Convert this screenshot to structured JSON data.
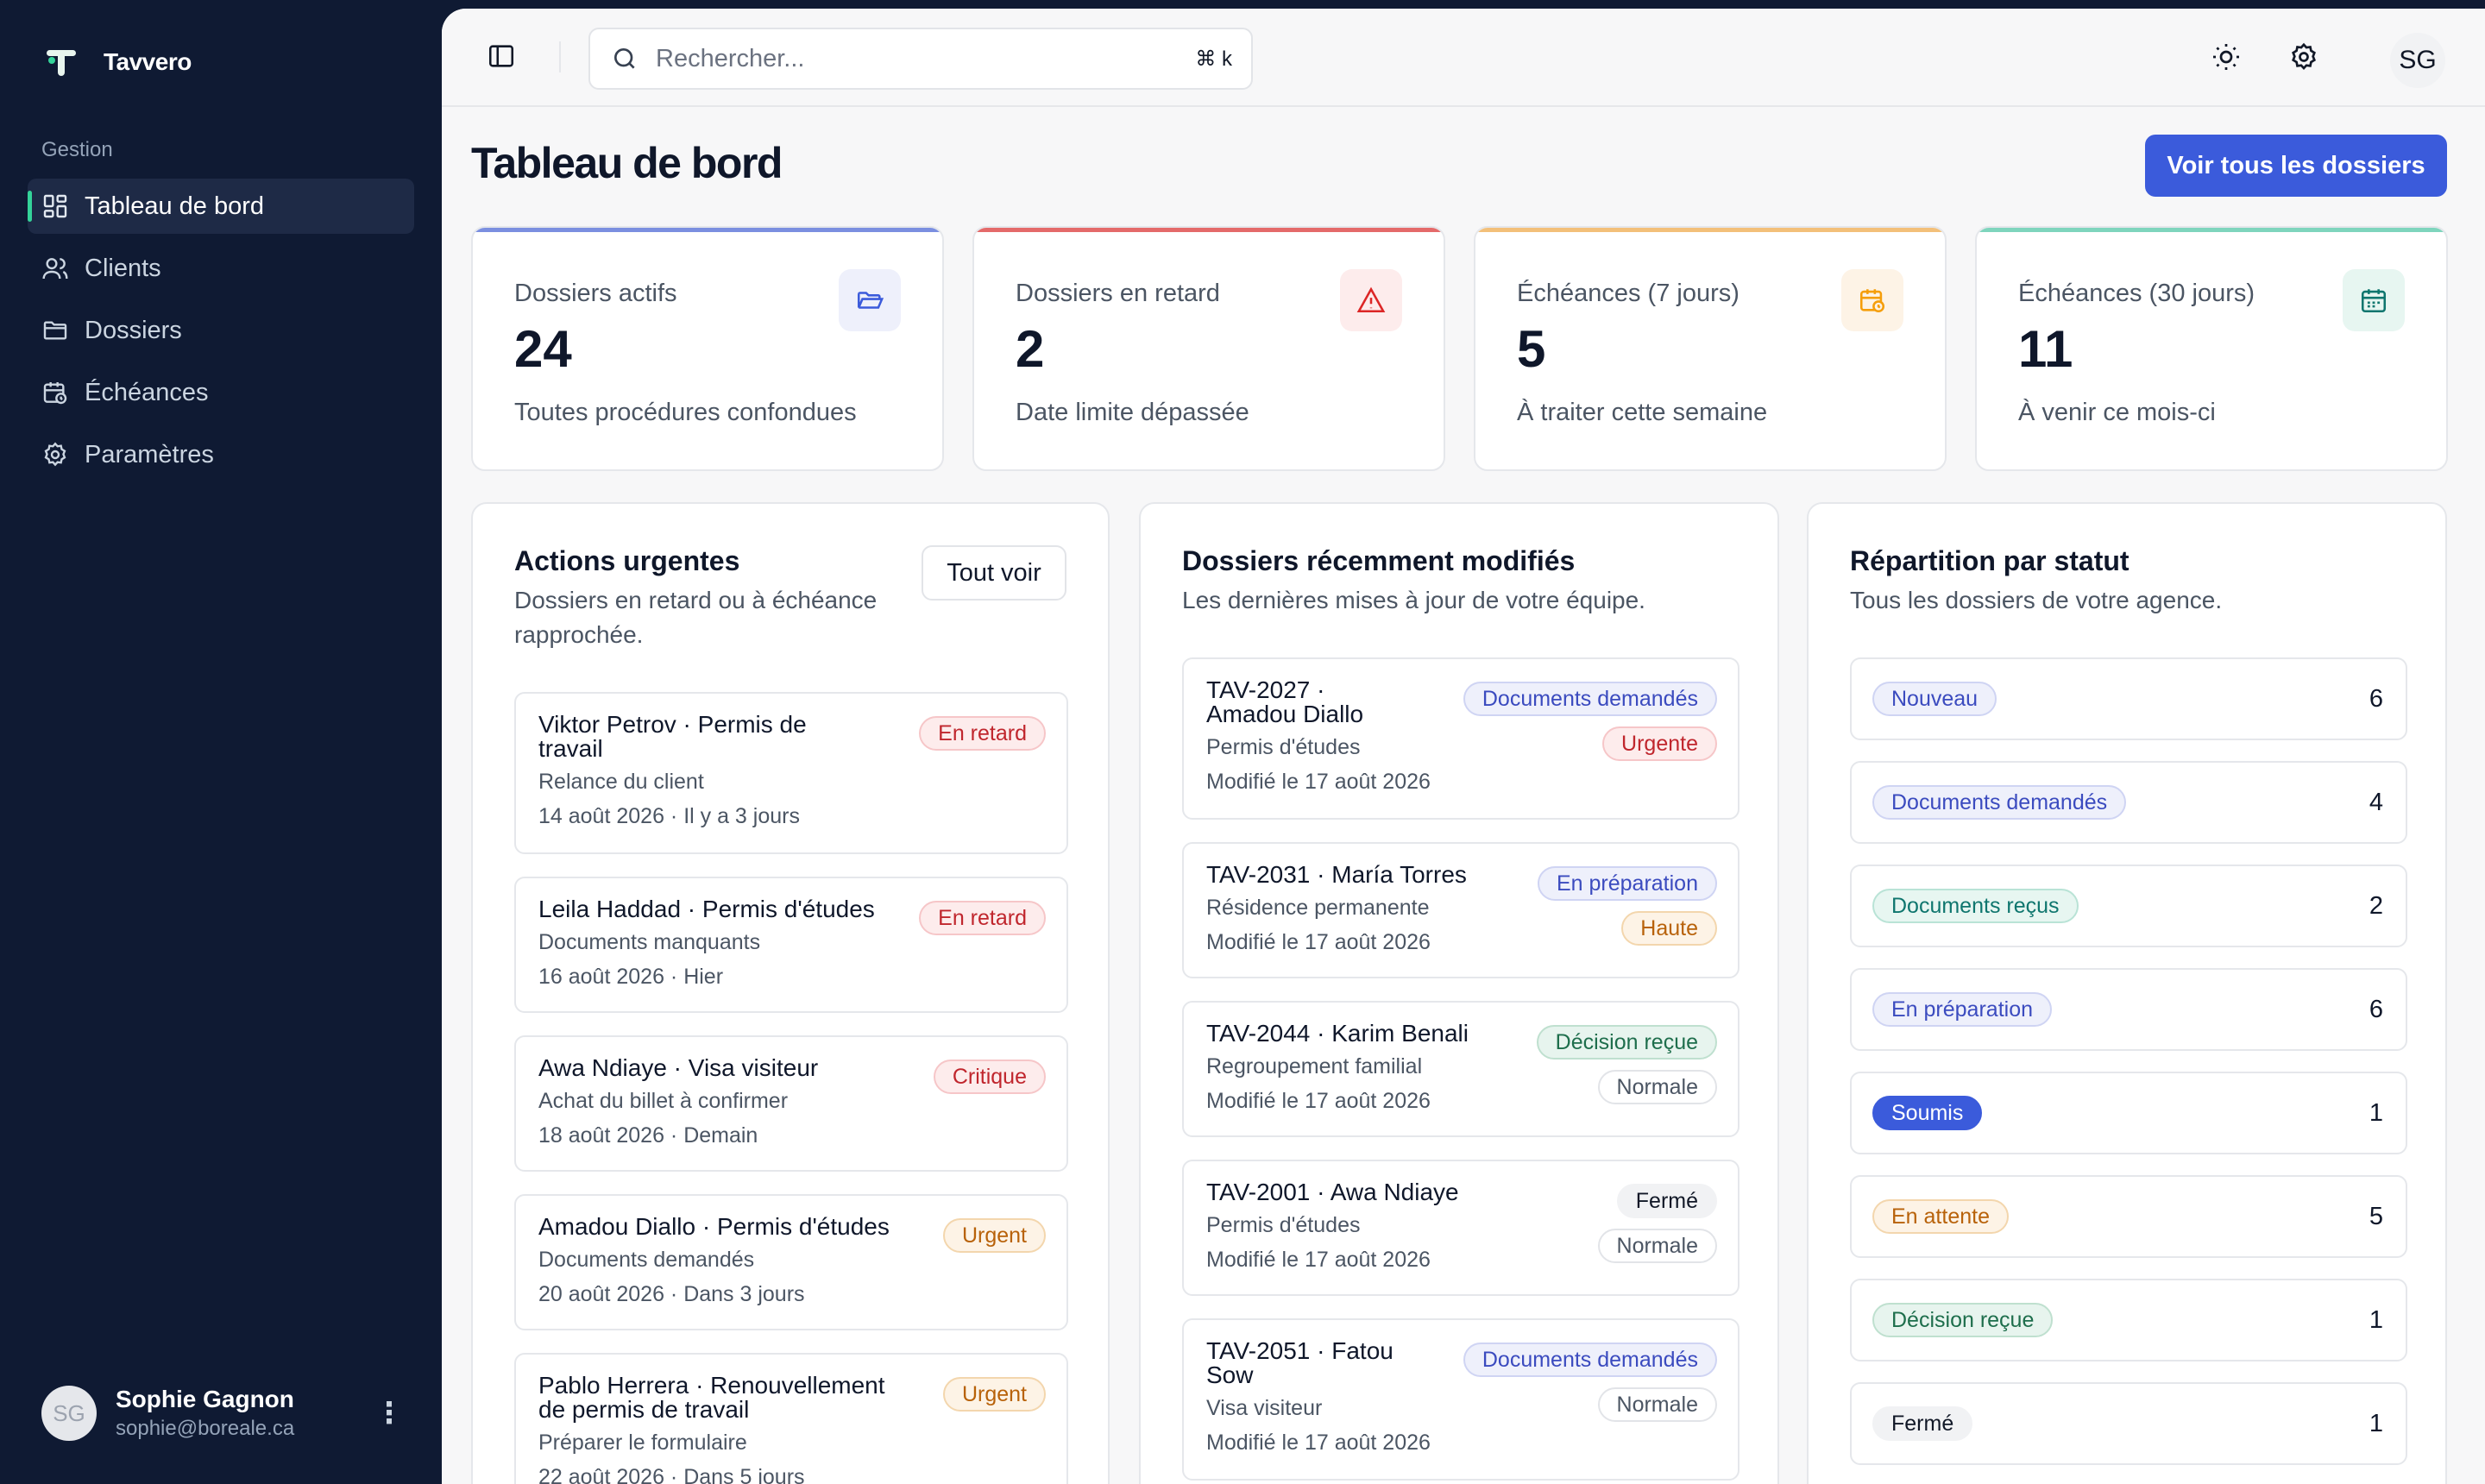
{
  "brand": {
    "name": "Tavvero"
  },
  "sidebar": {
    "group_label": "Gestion",
    "items": [
      {
        "label": "Tableau de bord",
        "icon": "dashboard-icon",
        "active": true
      },
      {
        "label": "Clients",
        "icon": "users-icon",
        "active": false
      },
      {
        "label": "Dossiers",
        "icon": "folder-icon",
        "active": false
      },
      {
        "label": "Échéances",
        "icon": "calendar-clock-icon",
        "active": false
      },
      {
        "label": "Paramètres",
        "icon": "gear-icon",
        "active": false
      }
    ],
    "user": {
      "initials": "SG",
      "name": "Sophie Gagnon",
      "email": "sophie@boreale.ca",
      "menu_glyph": "⋮"
    }
  },
  "topbar": {
    "search_placeholder": "Rechercher...",
    "shortcut": "⌘ k",
    "avatar_initials": "SG"
  },
  "page": {
    "title": "Tableau de bord",
    "primary_action": "Voir tous les dossiers"
  },
  "stats": [
    {
      "label": "Dossiers actifs",
      "value": "24",
      "sub": "Toutes procédures confondues",
      "accent": "#7b8fe0",
      "icon": "folder-open-icon",
      "icon_bg": "#eef0fb",
      "icon_color": "#3b5bdb"
    },
    {
      "label": "Dossiers en retard",
      "value": "2",
      "sub": "Date limite dépassée",
      "accent": "#e46a6a",
      "icon": "alert-triangle-icon",
      "icon_bg": "#fdecec",
      "icon_color": "#dc2626"
    },
    {
      "label": "Échéances (7 jours)",
      "value": "5",
      "sub": "À traiter cette semaine",
      "accent": "#f3c07a",
      "icon": "calendar-clock-icon",
      "icon_bg": "#fdf3e6",
      "icon_color": "#f59e0b"
    },
    {
      "label": "Échéances (30 jours)",
      "value": "11",
      "sub": "À venir ce mois-ci",
      "accent": "#7fd5bd",
      "icon": "calendar-icon",
      "icon_bg": "#e7f6f1",
      "icon_color": "#0f766e"
    }
  ],
  "urgent": {
    "title": "Actions urgentes",
    "description_line1": "Dossiers en retard ou à échéance",
    "description_line2": "rapprochée.",
    "see_all": "Tout voir",
    "items": [
      {
        "title_line1": "Viktor Petrov · Permis de",
        "title_line2": "travail",
        "sub": "Relance du client",
        "date": "14 août 2026 · Il y a 3 jours",
        "badge": "En retard",
        "tone": "red"
      },
      {
        "title_line1": "Leila Haddad · Permis d'études",
        "title_line2": "",
        "sub": "Documents manquants",
        "date": "16 août 2026 · Hier",
        "badge": "En retard",
        "tone": "red"
      },
      {
        "title_line1": "Awa Ndiaye · Visa visiteur",
        "title_line2": "",
        "sub": "Achat du billet à confirmer",
        "date": "18 août 2026 · Demain",
        "badge": "Critique",
        "tone": "red"
      },
      {
        "title_line1": "Amadou Diallo · Permis d'études",
        "title_line2": "",
        "sub": "Documents demandés",
        "date": "20 août 2026 · Dans 3 jours",
        "badge": "Urgent",
        "tone": "orange"
      },
      {
        "title_line1": "Pablo Herrera · Renouvellement",
        "title_line2": "de permis de travail",
        "sub": "Préparer le formulaire",
        "date": "22 août 2026 · Dans 5 jours",
        "badge": "Urgent",
        "tone": "orange"
      }
    ]
  },
  "recent": {
    "title": "Dossiers récemment modifiés",
    "description": "Les dernières mises à jour de votre équipe.",
    "items": [
      {
        "title_line1": "TAV-2027 ·",
        "title_line2": "Amadou Diallo",
        "sub": "Permis d'études",
        "date": "Modifié le 17 août 2026",
        "status": "Documents demandés",
        "status_tone": "indigo",
        "priority": "Urgente",
        "priority_tone": "red"
      },
      {
        "title_line1": "TAV-2031 · María Torres",
        "title_line2": "",
        "sub": "Résidence permanente",
        "date": "Modifié le 17 août 2026",
        "status": "En préparation",
        "status_tone": "indigo",
        "priority": "Haute",
        "priority_tone": "orange"
      },
      {
        "title_line1": "TAV-2044 · Karim Benali",
        "title_line2": "",
        "sub": "Regroupement familial",
        "date": "Modifié le 17 août 2026",
        "status": "Décision reçue",
        "status_tone": "green",
        "priority": "Normale",
        "priority_tone": "gray"
      },
      {
        "title_line1": "TAV-2001 · Awa Ndiaye",
        "title_line2": "",
        "sub": "Permis d'études",
        "date": "Modifié le 17 août 2026",
        "status": "Fermé",
        "status_tone": "neutral",
        "priority": "Normale",
        "priority_tone": "gray"
      },
      {
        "title_line1": "TAV-2051 · Fatou",
        "title_line2": "Sow",
        "sub": "Visa visiteur",
        "date": "Modifié le 17 août 2026",
        "status": "Documents demandés",
        "status_tone": "indigo",
        "priority": "Normale",
        "priority_tone": "gray"
      }
    ]
  },
  "distribution": {
    "title": "Répartition par statut",
    "description": "Tous les dossiers de votre agence.",
    "rows": [
      {
        "label": "Nouveau",
        "count": "6",
        "tone": "indigo"
      },
      {
        "label": "Documents demandés",
        "count": "4",
        "tone": "indigo"
      },
      {
        "label": "Documents reçus",
        "count": "2",
        "tone": "teal"
      },
      {
        "label": "En préparation",
        "count": "6",
        "tone": "indigo"
      },
      {
        "label": "Soumis",
        "count": "1",
        "tone": "solid"
      },
      {
        "label": "En attente",
        "count": "5",
        "tone": "orange"
      },
      {
        "label": "Décision reçue",
        "count": "1",
        "tone": "green"
      },
      {
        "label": "Fermé",
        "count": "1",
        "tone": "neutral"
      }
    ]
  }
}
